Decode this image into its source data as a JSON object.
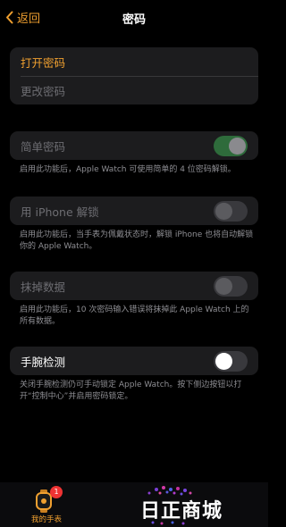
{
  "nav": {
    "back_label": "返回",
    "title": "密码"
  },
  "group1": {
    "open_passcode": "打开密码",
    "change_passcode": "更改密码"
  },
  "simple_passcode": {
    "label": "简单密码",
    "toggle_state": "on",
    "note": "启用此功能后，Apple Watch 可使用简单的 4 位密码解锁。"
  },
  "unlock_with_iphone": {
    "label": "用 iPhone 解锁",
    "toggle_state": "off",
    "note": "启用此功能后，当手表为佩戴状态时，解锁 iPhone 也将自动解锁你的 Apple Watch。"
  },
  "erase_data": {
    "label": "抹掉数据",
    "toggle_state": "off",
    "note": "启用此功能后，10 次密码输入错误将抹掉此 Apple Watch 上的所有数据。"
  },
  "wrist_detection": {
    "label": "手腕检测",
    "toggle_state": "off",
    "note": "关闭手腕检测仍可手动锁定 Apple Watch。按下侧边按钮以打开“控制中心”并启用密码锁定。"
  },
  "tabbar": {
    "my_watch_label": "我的手表",
    "badge_count": "1",
    "watch_icon": "watch-icon"
  },
  "watermark": {
    "text": "日正商城"
  },
  "colors": {
    "accent": "#f0a030",
    "background": "#000000",
    "cell": "#1c1c1e",
    "toggle_on": "#2e6b3b"
  }
}
